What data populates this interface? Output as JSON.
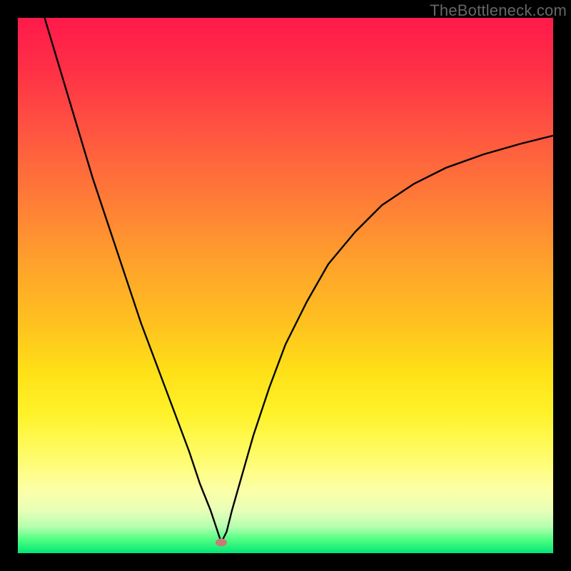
{
  "watermark": "TheBottleneck.com",
  "chart_data": {
    "type": "line",
    "title": "",
    "xlabel": "",
    "ylabel": "",
    "xlim": [
      0,
      100
    ],
    "ylim": [
      0,
      100
    ],
    "series": [
      {
        "name": "curve",
        "x": [
          5,
          8,
          11,
          14,
          17,
          20,
          23,
          26,
          29,
          32,
          34,
          36,
          37,
          38,
          39,
          40,
          42,
          44,
          47,
          50,
          54,
          58,
          63,
          68,
          74,
          80,
          87,
          94,
          100
        ],
        "y": [
          100,
          90,
          80,
          70,
          61,
          52,
          43,
          35,
          27,
          19,
          13,
          8,
          5,
          2,
          4,
          8,
          15,
          22,
          31,
          39,
          47,
          54,
          60,
          65,
          69,
          72,
          74.5,
          76.5,
          78
        ]
      }
    ],
    "marker": {
      "x": 38,
      "y": 2,
      "color": "#c97b77"
    },
    "background_gradient": {
      "top": "#ff1a4a",
      "mid": "#ffe017",
      "bottom": "#00e676"
    }
  }
}
